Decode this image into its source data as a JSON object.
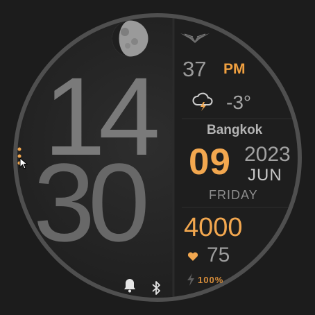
{
  "time": {
    "hours": "14",
    "minutes": "30",
    "seconds": "37",
    "ampm": "PM"
  },
  "weather": {
    "temperature": "-3°",
    "icon": "thunderstorm-icon"
  },
  "location": {
    "city": "Bangkok"
  },
  "date": {
    "day": "09",
    "year": "2023",
    "month": "JUN",
    "weekday": "FRIDAY"
  },
  "health": {
    "steps": "4000",
    "heart_rate": "75"
  },
  "battery": {
    "percent": "100%"
  },
  "icons": {
    "moon": "moon-phase-icon",
    "logo": "wings-logo-icon",
    "alarm": "bell-icon",
    "bluetooth": "bluetooth-icon",
    "heart": "heart-icon",
    "bolt": "lightning-icon",
    "menu": "more-dots-icon",
    "cursor": "cursor-icon"
  },
  "colors": {
    "accent": "#f2a74f",
    "text": "#a6a6a6",
    "background": "#1c1c1c"
  }
}
